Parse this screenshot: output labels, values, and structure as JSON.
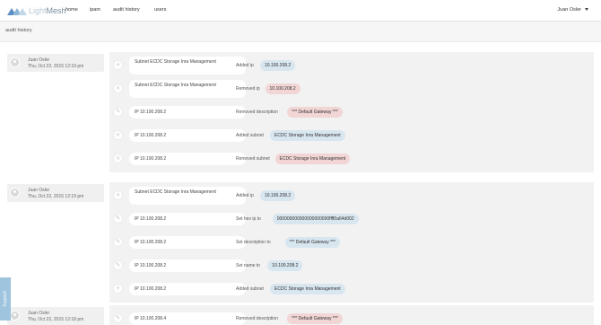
{
  "nav": {
    "logo_light": "Light",
    "logo_mesh": "Mesh",
    "items": [
      {
        "id": "home",
        "label": "home"
      },
      {
        "id": "ipam",
        "label": "ipam"
      },
      {
        "id": "audit-history",
        "label": "audit history"
      },
      {
        "id": "users",
        "label": "users"
      }
    ],
    "user": "Juan Osler"
  },
  "page": {
    "title": "audit history"
  },
  "support": {
    "label": "Support"
  },
  "groups": [
    {
      "user": "Juan Osler",
      "date": "Thu, Oct 22, 2015 12:19 pm",
      "entries": [
        {
          "icon": "plus-icon",
          "object": "Subnet ECDC Storage Inra Management",
          "action": "Added ip",
          "value": "10.100.208.2",
          "kind": "add"
        },
        {
          "icon": "times-icon",
          "object": "Subnet ECDC Storage Inra Management",
          "action": "Removed ip",
          "value": "10.100.208.2",
          "kind": "remove"
        },
        {
          "icon": "pencil-icon",
          "object": "IP 10.100.208.2",
          "action": "Removed description",
          "value": "*** Default Gateway ***",
          "kind": "remove"
        },
        {
          "icon": "plus-icon",
          "object": "IP 10.100.208.2",
          "action": "Added subnet",
          "value": "ECDC Storage Inra Management",
          "kind": "add"
        },
        {
          "icon": "times-icon",
          "object": "IP 10.100.208.2",
          "action": "Removed subnet",
          "value": "ECDC Storage Inra Management",
          "kind": "remove"
        }
      ]
    },
    {
      "user": "Juan Osler",
      "date": "Thu, Oct 22, 2015 12:19 pm",
      "entries": [
        {
          "icon": "plus-icon",
          "object": "Subnet ECDC Storage Inra Management",
          "action": "Added ip",
          "value": "10.100.208.2",
          "kind": "add"
        },
        {
          "icon": "pencil-icon",
          "object": "IP 10.100.208.2",
          "action": "Set hex ip to",
          "value": "000000000000000000000ffff0a64d002",
          "kind": "add"
        },
        {
          "icon": "pencil-icon",
          "object": "IP 10.100.208.2",
          "action": "Set description to",
          "value": "*** Default Gateway ***",
          "kind": "add"
        },
        {
          "icon": "pencil-icon",
          "object": "IP 10.100.208.2",
          "action": "Set name to",
          "value": "10.100.208.2",
          "kind": "add"
        },
        {
          "icon": "plus-icon",
          "object": "IP 10.100.208.2",
          "action": "Added subnet",
          "value": "ECDC Storage Inra Management",
          "kind": "add"
        }
      ]
    },
    {
      "user": "Juan Osler",
      "date": "Thu, Oct 22, 2015 12:18 pm",
      "entries": [
        {
          "icon": "pencil-icon",
          "object": "IP 10.100.208.4",
          "action": "Removed description",
          "value": "*** Default Gateway ***",
          "kind": "remove"
        }
      ]
    }
  ]
}
